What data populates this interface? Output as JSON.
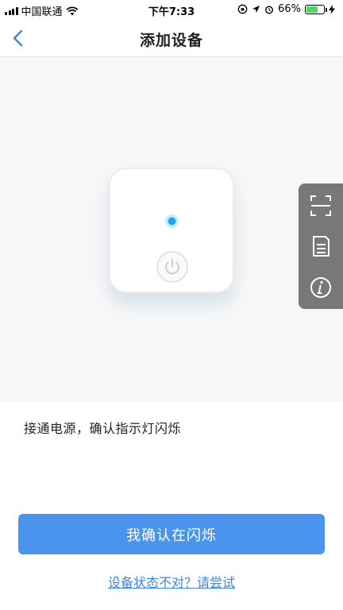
{
  "status_bar": {
    "carrier": "中国联通",
    "time": "下午7:33",
    "battery_percent": "66%",
    "battery_level": 0.66
  },
  "nav": {
    "title": "添加设备",
    "back_icon": "chevron-left-icon"
  },
  "device": {
    "led_color": "#1aa6e8",
    "icons": [
      "led-indicator",
      "power-icon"
    ]
  },
  "side_toolbar": {
    "items": [
      {
        "icon": "scan-icon"
      },
      {
        "icon": "manual-icon"
      },
      {
        "icon": "info-icon"
      }
    ]
  },
  "instruction": "接通电源，确认指示灯闪烁",
  "confirm_button": "我确认在闪烁",
  "help_link": "设备状态不对？请尝试",
  "colors": {
    "primary": "#4a94ee",
    "link": "#3b86e6",
    "toolbar_bg": "#777878"
  }
}
